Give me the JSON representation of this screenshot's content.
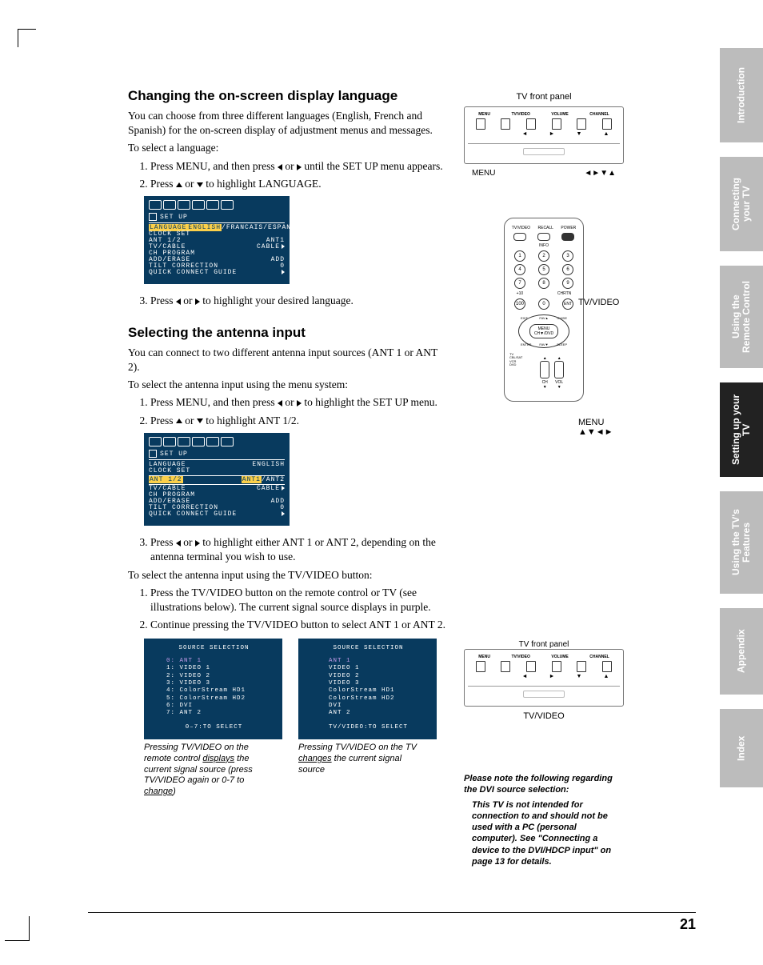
{
  "page_number": "21",
  "section1": {
    "heading": "Changing the on-screen display language",
    "intro": "You can choose from three different languages (English, French and Spanish) for the on-screen display of adjustment menus and messages.",
    "lead": "To select a language:",
    "steps": {
      "s1a": "Press MENU, and then press ",
      "s1b": " or ",
      "s1c": " until the SET UP menu appears.",
      "s2a": "Press ",
      "s2b": " or ",
      "s2c": " to highlight LANGUAGE.",
      "s3a": "Press ",
      "s3b": " or ",
      "s3c": " to highlight your desired language."
    }
  },
  "osd1": {
    "setup": "SET UP",
    "rows": {
      "lang_k": "LANGUAGE",
      "lang_v_en": "ENGLISH",
      "lang_v_fr": "FRANCAIS",
      "lang_v_es": "ESPANOL",
      "clock_k": "CLOCK SET",
      "ant_k": "ANT 1/2",
      "ant_v": "ANT1",
      "tvc_k": "TV/CABLE",
      "tvc_v": "CABLE",
      "chp_k": "CH PROGRAM",
      "ae_k": "ADD/ERASE",
      "ae_v": "ADD",
      "tilt_k": "TILT CORRECTION",
      "tilt_v": "0",
      "qc_k": "QUICK CONNECT GUIDE"
    }
  },
  "section2": {
    "heading": "Selecting the antenna input",
    "intro": "You can connect to two different antenna input sources (ANT 1 or ANT 2).",
    "lead1": "To select the antenna input using the menu system:",
    "steps1": {
      "s1a": "Press MENU, and then press ",
      "s1b": " or ",
      "s1c": " to highlight the SET UP menu.",
      "s2a": "Press ",
      "s2b": " or ",
      "s2c": " to highlight ANT 1/2.",
      "s3a": "Press ",
      "s3b": " or ",
      "s3c": " to highlight either ANT 1 or ANT 2, depending on the antenna terminal you wish to use."
    },
    "lead2": "To select the antenna input using the TV/VIDEO button:",
    "steps2": {
      "s1": "Press the TV/VIDEO button on the remote control or TV (see illustrations below). The current signal source displays in purple.",
      "s2": "Continue pressing the TV/VIDEO button to select ANT 1 or ANT 2."
    }
  },
  "osd2": {
    "setup": "SET UP",
    "rows": {
      "lang_k": "LANGUAGE",
      "lang_v": "ENGLISH",
      "clock_k": "CLOCK SET",
      "ant_k": "ANT 1/2",
      "ant_v1": "ANT1",
      "ant_v2": "ANT2",
      "tvc_k": "TV/CABLE",
      "tvc_v": "CABLE",
      "chp_k": "CH PROGRAM",
      "ae_k": "ADD/ERASE",
      "ae_v": "ADD",
      "tilt_k": "TILT CORRECTION",
      "tilt_v": "0",
      "qc_k": "QUICK CONNECT GUIDE"
    }
  },
  "source1": {
    "title": "SOURCE SELECTION",
    "items": [
      "0: ANT 1",
      "1: VIDEO 1",
      "2: VIDEO 2",
      "3: VIDEO 3",
      "4: ColorStream HD1",
      "5: ColorStream HD2",
      "6: DVI",
      "7: ANT 2"
    ],
    "footer": "0–7:TO SELECT",
    "cap_a": "Pressing TV/VIDEO on the remote control ",
    "cap_b": "displays",
    "cap_c": " the current signal source (press TV/VIDEO again or 0-7 to ",
    "cap_d": "change",
    "cap_e": ")"
  },
  "source2": {
    "title": "SOURCE SELECTION",
    "items": [
      "ANT 1",
      "VIDEO 1",
      "VIDEO 2",
      "VIDEO 3",
      "ColorStream HD1",
      "ColorStream HD2",
      "DVI",
      "ANT 2"
    ],
    "footer": "TV/VIDEO:TO SELECT",
    "cap_a": "Pressing TV/VIDEO on the TV ",
    "cap_b": "changes",
    "cap_c": " the current signal source"
  },
  "panel": {
    "title": "TV front panel",
    "labels": {
      "menu": "MENU",
      "tvvideo": "TV/VIDEO",
      "volume": "VOLUME",
      "channel": "CHANNEL"
    },
    "under_menu": "MENU",
    "under_arrows": "◄►▼▲",
    "under_tvvideo": "TV/VIDEO"
  },
  "remote": {
    "top": {
      "tvvideo": "TV/VIDEO",
      "recall": "RECALL",
      "power": "POWER",
      "info": "INFO"
    },
    "numpad": [
      "1",
      "2",
      "3",
      "4",
      "5",
      "6",
      "7",
      "8",
      "9",
      "100",
      "0",
      "ENT"
    ],
    "numpad_sub": {
      "plus10": "+10",
      "chrtn": "CHRTN"
    },
    "dpad": {
      "exit": "EXIT",
      "favup": "FAV▲",
      "guide": "GUIDE",
      "menu": "MENU",
      "chdndvd": "CH▼/DVD",
      "enter": "ENTER",
      "favdn": "FAV▼",
      "sleep": "SLEEP"
    },
    "bottom": {
      "modes": "TV\nCBL/SAT\nVCR\nDVD",
      "ch": "CH",
      "vol": "VOL"
    },
    "side_tvvideo": "TV/VIDEO",
    "side_menu": "MENU",
    "side_arrows": "▲▼◄►"
  },
  "note": {
    "lead": "Please note the following regarding the DVI source selection:",
    "body": "This TV is not intended for connection to and should not be used with a PC (personal computer). See \"Connecting a device to the DVI/HDCP input\" on page 13 for details."
  },
  "tabs": {
    "t1": "Introduction",
    "t2": "Connecting your TV",
    "t3": "Using the Remote Control",
    "t4": "Setting up your TV",
    "t5": "Using the TV's Features",
    "t6": "Appendix",
    "t7": "Index"
  }
}
